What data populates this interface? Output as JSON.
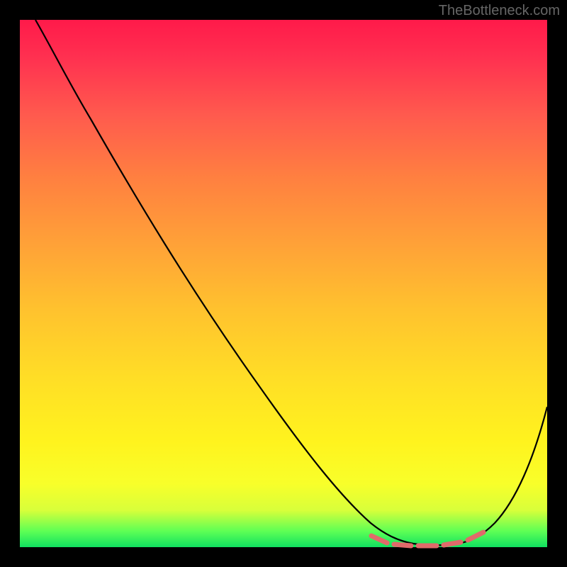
{
  "watermark": "TheBottleneck.com",
  "chart_data": {
    "type": "line",
    "title": "",
    "xlabel": "",
    "ylabel": "",
    "xlim": [
      0,
      100
    ],
    "ylim": [
      0,
      100
    ],
    "series": [
      {
        "name": "curve",
        "x": [
          3,
          8,
          15,
          25,
          35,
          45,
          55,
          63,
          68,
          72,
          76,
          80,
          84,
          88,
          92,
          96,
          100
        ],
        "y": [
          100,
          93,
          83,
          68,
          53,
          38,
          23,
          11,
          5,
          2,
          0.5,
          0.5,
          0.5,
          1.5,
          5,
          14,
          30
        ]
      },
      {
        "name": "highlight-dashes",
        "x": [
          70,
          73.5,
          78,
          82,
          85.5
        ],
        "y": [
          1.2,
          0.7,
          0.5,
          0.9,
          1.8
        ]
      }
    ],
    "colors": {
      "curve": "#000000",
      "highlight": "#e06a6a",
      "gradient_top": "#ff1a4a",
      "gradient_mid": "#ffde26",
      "gradient_bottom": "#10e060"
    }
  }
}
